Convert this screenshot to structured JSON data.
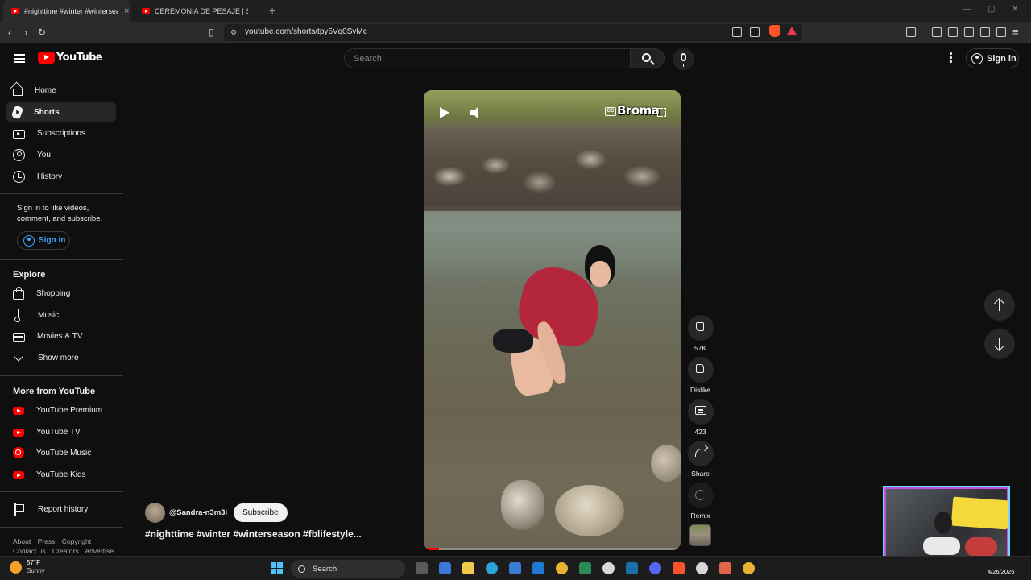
{
  "browser": {
    "tabs": [
      {
        "title": "#nighttime #winter #winterseason",
        "active": true
      },
      {
        "title": "CEREMONIA DE PESAJE | SUPERNOV",
        "active": false
      }
    ],
    "new_tab": "+",
    "url": "youtube.com/shorts/tpy5Vq0SvMc"
  },
  "header": {
    "logo_text": "YouTube",
    "search_placeholder": "Search",
    "sign_in": "Sign in"
  },
  "sidebar": {
    "main": [
      {
        "label": "Home",
        "icon": "home-icon"
      },
      {
        "label": "Shorts",
        "icon": "shorts-icon",
        "active": true
      },
      {
        "label": "Subscriptions",
        "icon": "subscriptions-icon"
      },
      {
        "label": "You",
        "icon": "you-icon"
      },
      {
        "label": "History",
        "icon": "history-icon"
      }
    ],
    "signin_prompt": "Sign in to like videos, comment, and subscribe.",
    "signin_button": "Sign in",
    "explore_heading": "Explore",
    "explore": [
      {
        "label": "Shopping",
        "icon": "shopping-bag-icon"
      },
      {
        "label": "Music",
        "icon": "music-note-icon"
      },
      {
        "label": "Movies & TV",
        "icon": "film-icon"
      },
      {
        "label": "Show more",
        "icon": "chevron-down-icon"
      }
    ],
    "more_heading": "More from YouTube",
    "more": [
      {
        "label": "YouTube Premium",
        "icon": "youtube-premium-icon"
      },
      {
        "label": "YouTube TV",
        "icon": "youtube-tv-icon"
      },
      {
        "label": "YouTube Music",
        "icon": "youtube-music-icon"
      },
      {
        "label": "YouTube Kids",
        "icon": "youtube-kids-icon"
      }
    ],
    "report_history": "Report history",
    "footer_row1": [
      "About",
      "Press",
      "Copyright"
    ],
    "footer_row2": [
      "Contact us",
      "Creators",
      "Advertise"
    ]
  },
  "player": {
    "watermark": "Broma",
    "cc_label": "CC",
    "progress": 0.06
  },
  "actions": {
    "like_count": "57K",
    "dislike_label": "Dislike",
    "comment_count": "423",
    "share_label": "Share",
    "remix_label": "Remix"
  },
  "short": {
    "channel": "@Sandra-n3m3i",
    "subscribe": "Subscribe",
    "title": "#nighttime #winter #winterseason #fblifestyle..."
  },
  "taskbar": {
    "temperature": "57°F",
    "condition": "Sunny",
    "search": "Search",
    "date": "4/26/2026"
  },
  "colors": {
    "background": "#0f0f0f",
    "brand_red": "#ff0000",
    "link_blue": "#3ea6ff"
  }
}
